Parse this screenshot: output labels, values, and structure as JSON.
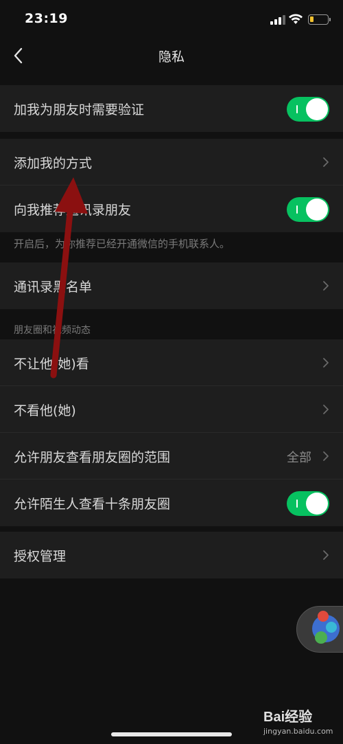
{
  "status_bar": {
    "time": "23:19"
  },
  "nav": {
    "title": "隐私"
  },
  "groups": {
    "verify": {
      "label": "加我为朋友时需要验证",
      "toggle_on": true
    },
    "add_methods": {
      "add_way_label": "添加我的方式",
      "recommend_label": "向我推荐通讯录朋友",
      "recommend_on": true
    },
    "recommend_note": "开启后，为你推荐已经开通微信的手机联系人。",
    "blacklist": {
      "label": "通讯录黑名单"
    },
    "moments_section_title": "朋友圈和视频动态",
    "moments": {
      "hide_from_label": "不让他(她)看",
      "dont_see_label": "不看他(她)",
      "range_label": "允许朋友查看朋友圈的范围",
      "range_value": "全部",
      "stranger_label": "允许陌生人查看十条朋友圈",
      "stranger_on": true
    },
    "auth": {
      "label": "授权管理"
    }
  },
  "watermark": {
    "logo": "Bai经验",
    "sub": "jingyan.baidu.com"
  },
  "colors": {
    "background": "#111111",
    "row_bg": "#1e1e1e",
    "toggle_on": "#07c160",
    "arrow": "#8b1010"
  },
  "icons": [
    "back-arrow-icon",
    "chevron-right-icon",
    "wifi-icon",
    "battery-icon",
    "signal-icon"
  ]
}
